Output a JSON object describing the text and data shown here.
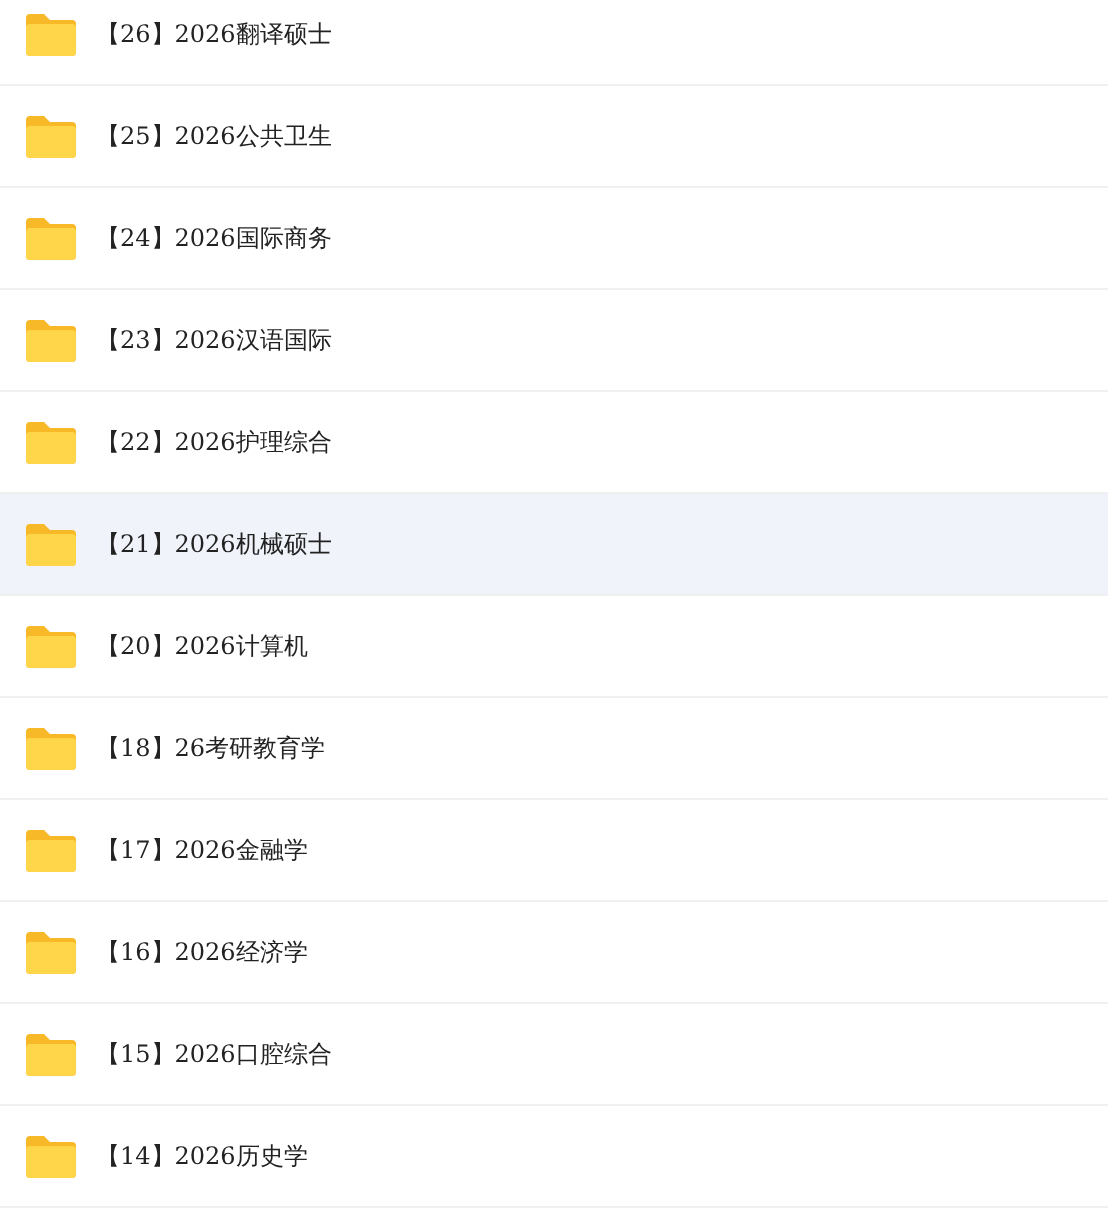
{
  "folders": [
    {
      "name": "【26】2026翻译硕士",
      "selected": false
    },
    {
      "name": "【25】2026公共卫生",
      "selected": false
    },
    {
      "name": "【24】2026国际商务",
      "selected": false
    },
    {
      "name": "【23】2026汉语国际",
      "selected": false
    },
    {
      "name": "【22】2026护理综合",
      "selected": false
    },
    {
      "name": "【21】2026机械硕士",
      "selected": true
    },
    {
      "name": "【20】2026计算机",
      "selected": false
    },
    {
      "name": "【18】26考研教育学",
      "selected": false
    },
    {
      "name": "【17】2026金融学",
      "selected": false
    },
    {
      "name": "【16】2026经济学",
      "selected": false
    },
    {
      "name": "【15】2026口腔综合",
      "selected": false
    },
    {
      "name": "【14】2026历史学",
      "selected": false
    }
  ]
}
